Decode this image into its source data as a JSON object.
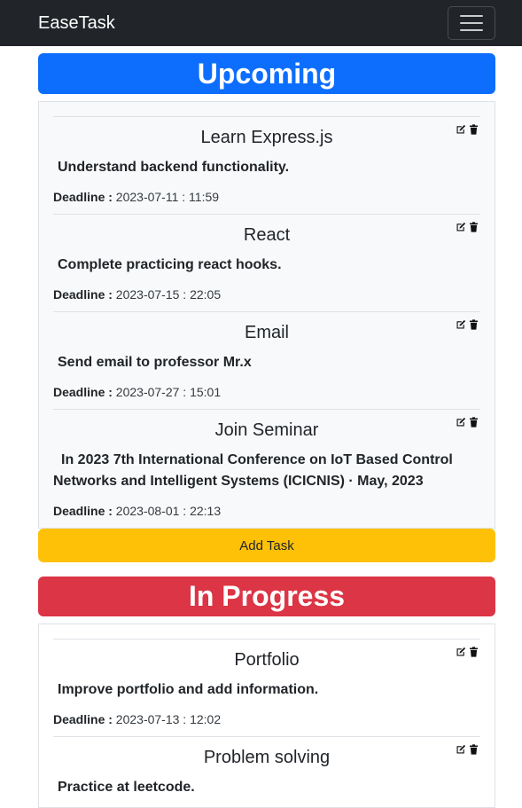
{
  "navbar": {
    "brand": "EaseTask",
    "toggle_icon": "hamburger-menu-icon"
  },
  "sections": {
    "upcoming": {
      "title": "Upcoming",
      "color": "#0d6efd",
      "tasks": [
        {
          "title": "Learn Express.js",
          "description": "Understand backend functionality.",
          "deadline_label": "Deadline :",
          "deadline": "2023-07-11 : 11:59"
        },
        {
          "title": "React",
          "description": "Complete practicing react hooks.",
          "deadline_label": "Deadline :",
          "deadline": "2023-07-15 : 22:05"
        },
        {
          "title": "Email",
          "description": "Send email to professor Mr.x",
          "deadline_label": "Deadline :",
          "deadline": "2023-07-27 : 15:01"
        },
        {
          "title": "Join Seminar",
          "description": "In 2023 7th International Conference on IoT Based Control Networks and Intelligent Systems (ICICNIS) · May, 2023",
          "deadline_label": "Deadline :",
          "deadline": "2023-08-01 : 22:13"
        }
      ],
      "add_button": "Add Task"
    },
    "in_progress": {
      "title": "In Progress",
      "color": "#dc3545",
      "tasks": [
        {
          "title": "Portfolio",
          "description": "Improve portfolio and add information.",
          "deadline_label": "Deadline :",
          "deadline": "2023-07-13 : 12:02"
        },
        {
          "title": "Problem solving",
          "description": "Practice at leetcode."
        }
      ]
    }
  },
  "icons": {
    "edit": "edit-icon",
    "delete": "trash-icon"
  },
  "colors": {
    "navbar": "#212529",
    "add_button": "#ffc107"
  }
}
